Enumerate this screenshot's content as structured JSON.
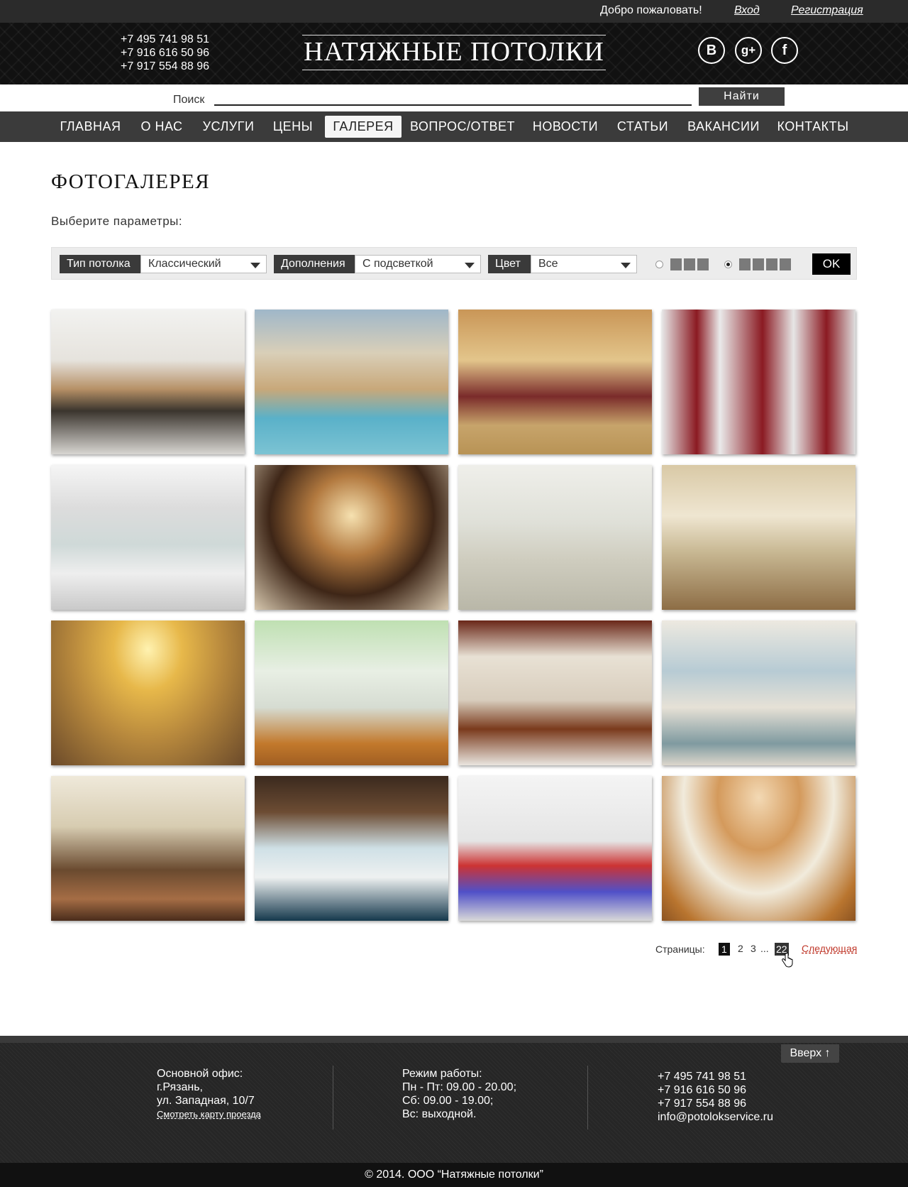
{
  "topbar": {
    "welcome": "Добро пожаловать!",
    "login": "Вход",
    "register": "Регистрация"
  },
  "header": {
    "phones": [
      "+7 495 741 98 51",
      "+7 916 616 50 96",
      "+7 917 554 88 96"
    ],
    "logo": "НАТЯЖНЫЕ ПОТОЛКИ",
    "social": [
      "В",
      "g+",
      "f"
    ]
  },
  "search": {
    "label": "Поиск",
    "value": "",
    "button": "Найти"
  },
  "nav": {
    "items": [
      "ГЛАВНАЯ",
      "О НАС",
      "УСЛУГИ",
      "ЦЕНЫ",
      "ГАЛЕРЕЯ",
      "ВОПРОС/ОТВЕТ",
      "НОВОСТИ",
      "СТАТЬИ",
      "ВАКАНСИИ",
      "КОНТАКТЫ"
    ],
    "active": "ГАЛЕРЕЯ"
  },
  "page": {
    "title": "ФОТОГАЛЕРЕЯ",
    "subtitle": "Выберите параметры:"
  },
  "filters": {
    "type_label": "Тип потолка",
    "type_value": "Классический",
    "addons_label": "Дополнения",
    "addons_value": "С подсветкой",
    "color_label": "Цвет",
    "color_value": "Все",
    "ok": "OK"
  },
  "pager": {
    "label": "Страницы:",
    "pages": [
      "1",
      "2",
      "3",
      "...",
      "22"
    ],
    "next": "Следующая"
  },
  "footer": {
    "up": "Вверх ↑",
    "office": [
      "Основной офис:",
      "г.Рязань,",
      "ул. Западная, 10/7"
    ],
    "map_link": "Смотреть карту проезда",
    "hours": [
      "Режим работы:",
      "Пн - Пт: 09.00 - 20.00;",
      "Сб: 09.00 - 19.00;",
      "Вс: выходной."
    ],
    "contacts": [
      "+7 495 741 98 51",
      "+7 916 616 50 96",
      "+7 917 554 88 96",
      "info@potolokservice.ru"
    ],
    "copyright": "© 2014. ООО “Натяжные потолки”"
  }
}
